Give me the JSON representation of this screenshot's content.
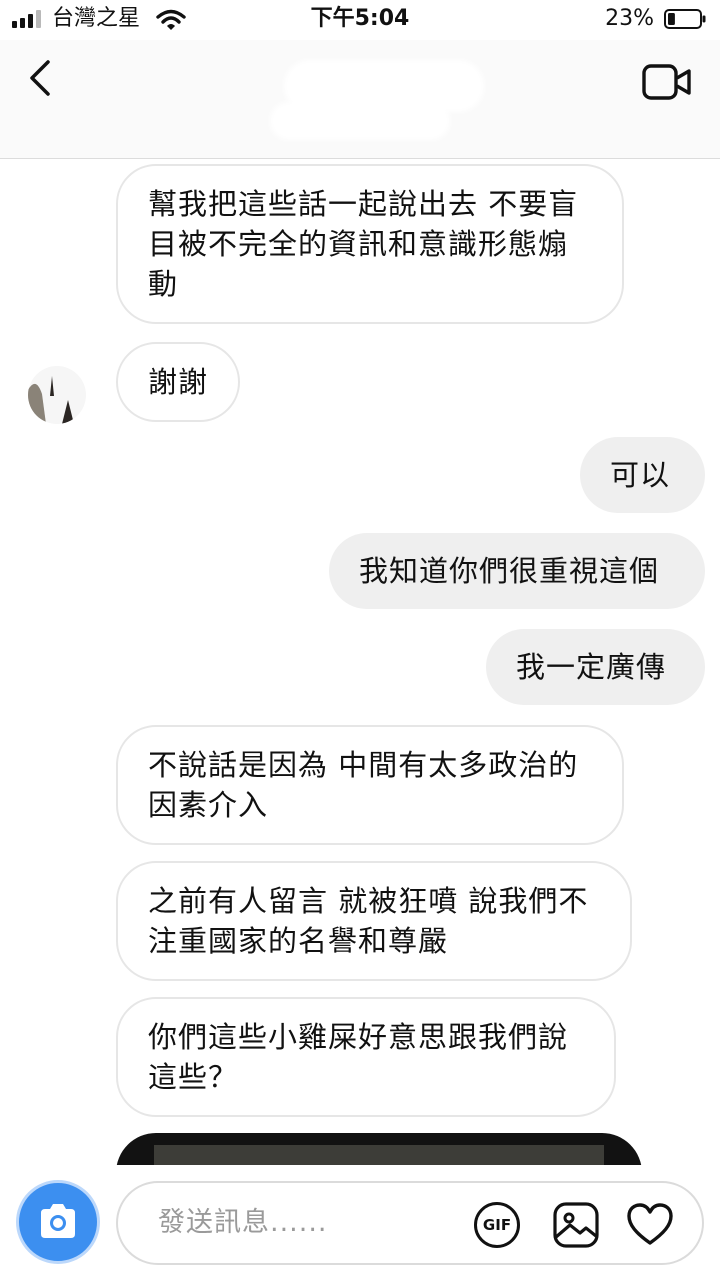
{
  "status_bar": {
    "carrier": "台灣之星",
    "time": "下午5:04",
    "battery_percent": "23%",
    "battery_level": 0.23,
    "signal_bars_filled": 3
  },
  "header": {
    "back_icon": "chevron-left-icon",
    "video_icon": "video-camera-icon"
  },
  "messages": [
    {
      "direction": "incoming",
      "text": "幫我把這些話一起說出去 不要盲目被不完全的資訊和意識形態煽動"
    },
    {
      "direction": "incoming",
      "text": "謝謝"
    },
    {
      "direction": "outgoing",
      "text": "可以"
    },
    {
      "direction": "outgoing",
      "text": "我知道你們很重視這個"
    },
    {
      "direction": "outgoing",
      "text": "我一定廣傳"
    },
    {
      "direction": "incoming",
      "text": "不說話是因為 中間有太多政治的因素介入"
    },
    {
      "direction": "incoming",
      "text": "之前有人留言 就被狂噴 說我們不注重國家的名譽和尊嚴"
    },
    {
      "direction": "incoming",
      "text": "你們這些小雞屎好意思跟我們說這些？"
    }
  ],
  "composer": {
    "placeholder": "發送訊息......",
    "gif_label": "GIF",
    "camera_icon": "camera-icon",
    "photo_icon": "image-icon",
    "heart_icon": "heart-icon"
  },
  "colors": {
    "accent_blue": "#3c8ff0",
    "outgoing_bubble": "#efefef",
    "incoming_border": "#e6e6e6"
  }
}
